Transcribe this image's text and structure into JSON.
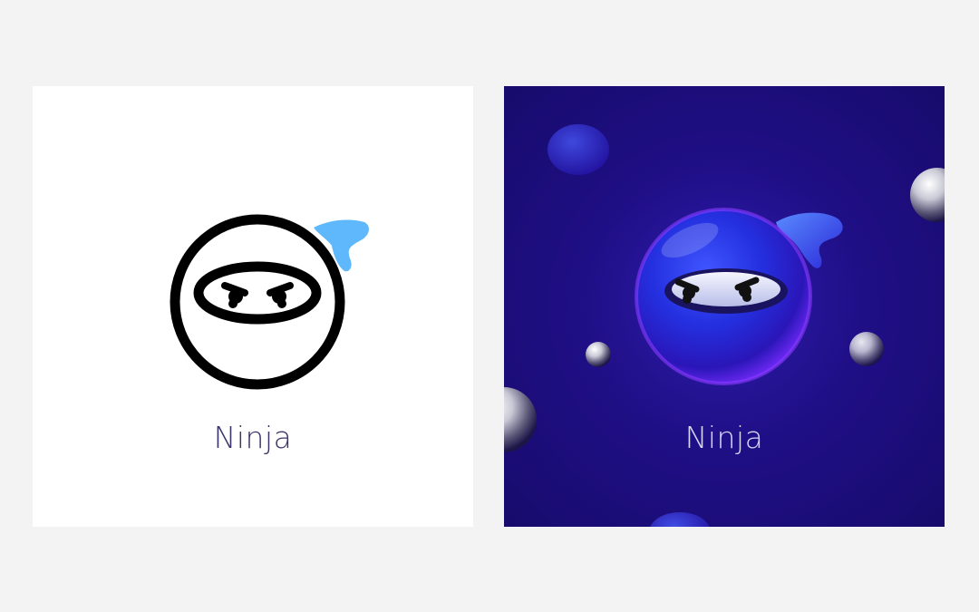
{
  "cards": [
    {
      "style": "flat",
      "label": "Ninja",
      "icon": "ninja-icon",
      "colors": {
        "background": "#ffffff",
        "outline": "#000000",
        "headband_tail": "#5eb8fb",
        "label": "#3a3468"
      }
    },
    {
      "style": "3d",
      "label": "Ninja",
      "icon": "ninja-3d-icon",
      "colors": {
        "background": "#1f0f86",
        "ball": "#2b3cf0",
        "glow": "#7a2cff",
        "label": "#d7d6f3"
      }
    }
  ],
  "page": {
    "background": "#f3f3f3"
  }
}
